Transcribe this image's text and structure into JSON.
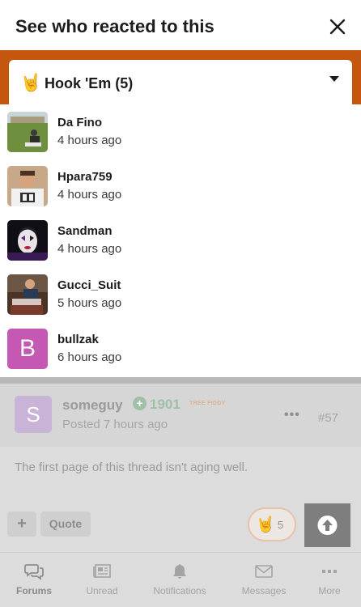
{
  "modal": {
    "title": "See who reacted to this",
    "selector": {
      "emoji": "🤘",
      "label": "Hook 'Em (5)"
    },
    "reactors": [
      {
        "name": "Da Fino",
        "time": "4 hours ago",
        "avatar": "photo-avatar"
      },
      {
        "name": "Hpara759",
        "time": "4 hours ago",
        "avatar": "photo-avatar"
      },
      {
        "name": "Sandman",
        "time": "4 hours ago",
        "avatar": "photo-avatar"
      },
      {
        "name": "Gucci_Suit",
        "time": "5 hours ago",
        "avatar": "photo-avatar"
      },
      {
        "name": "bullzak",
        "time": "6 hours ago",
        "avatar_letter": "B",
        "avatar_color": "#c558b2"
      }
    ]
  },
  "post": {
    "avatar_letter": "S",
    "username": "someguy",
    "score": "1901",
    "flair": "TREE FIDDY",
    "posted": "Posted 7 hours ago",
    "more": "•••",
    "number": "#57",
    "body": "The first page of this thread isn't aging well.",
    "add_label": "+",
    "quote_label": "Quote",
    "reaction": {
      "emoji": "🤘",
      "count": "5"
    }
  },
  "tabbar": {
    "tabs": [
      {
        "label": "Forums",
        "icon": "forums-icon",
        "active": true
      },
      {
        "label": "Unread",
        "icon": "newspaper-icon"
      },
      {
        "label": "Notifications",
        "icon": "bell-icon"
      },
      {
        "label": "Messages",
        "icon": "envelope-icon"
      },
      {
        "label": "More",
        "icon": "more-icon"
      }
    ]
  },
  "colors": {
    "accent": "#c4560e",
    "letter_avatar": "#c558b2"
  }
}
